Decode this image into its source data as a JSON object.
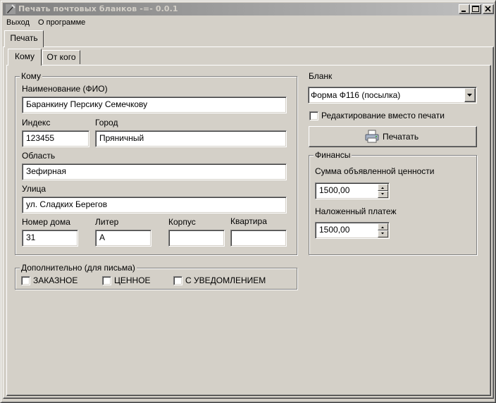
{
  "window": {
    "title": "Печать почтовых бланков -=- 0.0.1"
  },
  "menu": {
    "items": [
      "Выход",
      "О программе"
    ]
  },
  "outer_tabs": [
    {
      "label": "Печать"
    }
  ],
  "inner_tabs": [
    {
      "label": "Кому"
    },
    {
      "label": "От кого"
    }
  ],
  "recipient": {
    "group_title": "Кому",
    "name_label": "Наименование (ФИО)",
    "name_value": "Баранкину Персику Семечкову",
    "index_label": "Индекс",
    "index_value": "123455",
    "city_label": "Город",
    "city_value": "Пряничный",
    "region_label": "Область",
    "region_value": "Зефирная",
    "street_label": "Улица",
    "street_value": "ул. Сладких Берегов",
    "house_label": "Номер дома",
    "house_value": "31",
    "liter_label": "Литер",
    "liter_value": "А",
    "building_label": "Корпус",
    "building_value": "",
    "apartment_label": "Квартира",
    "apartment_value": ""
  },
  "extra": {
    "group_title": "Дополнительно (для письма)",
    "options": [
      {
        "label": "ЗАКАЗНОЕ",
        "checked": false
      },
      {
        "label": "ЦЕННОЕ",
        "checked": false
      },
      {
        "label": "С УВЕДОМЛЕНИЕМ",
        "checked": false
      }
    ]
  },
  "blank": {
    "label": "Бланк",
    "selected": "Форма Ф116 (посылка)",
    "edit_checkbox_label": "Редактирование вместо печати",
    "edit_checked": false,
    "print_button": "Печатать"
  },
  "finance": {
    "group_title": "Финансы",
    "declared_label": "Сумма объявленной ценности",
    "declared_value": "1500,00",
    "cod_label": "Наложенный платеж",
    "cod_value": "1500,00"
  }
}
